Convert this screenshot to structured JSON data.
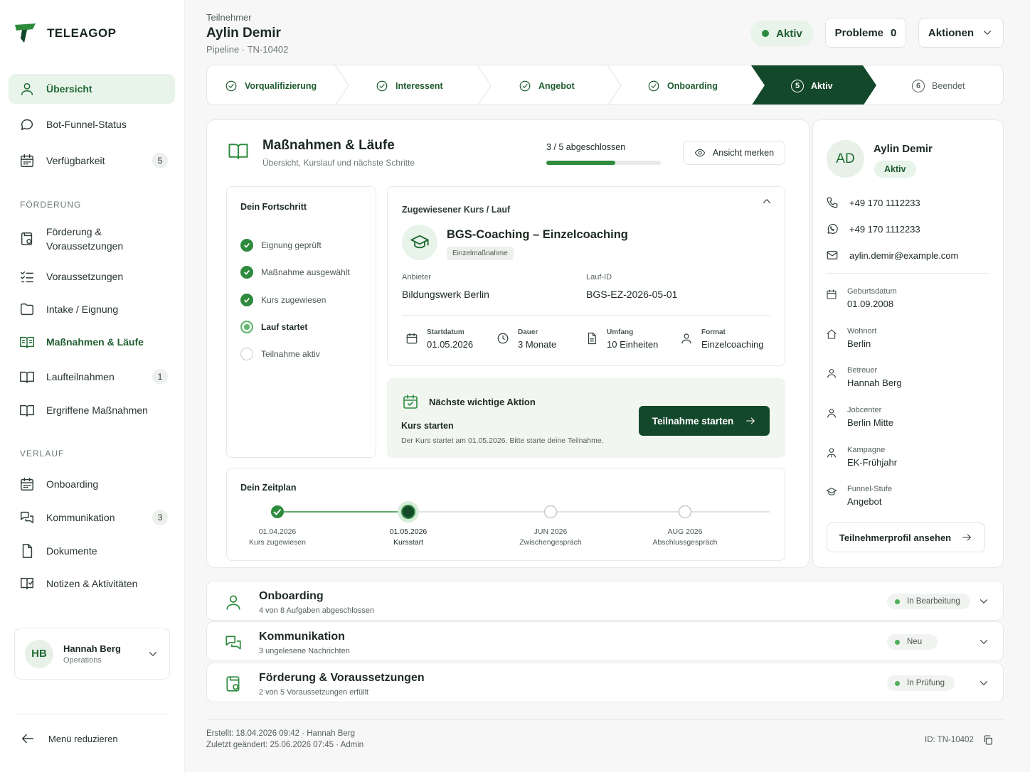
{
  "brand": {
    "name": "TELEAGOP"
  },
  "sidebar": {
    "items": [
      {
        "label": "Übersicht"
      },
      {
        "label": "Bot-Funnel-Status"
      },
      {
        "label": "Verfügbarkeit",
        "badge": "5"
      }
    ],
    "section_foerderung": "FÖRDERUNG",
    "foerderung_items": [
      {
        "label": "Förderung & Voraussetzungen"
      },
      {
        "label": "Voraussetzungen"
      },
      {
        "label": "Intake / Eignung"
      },
      {
        "label": "Maßnahmen & Läufe"
      },
      {
        "label": "Laufteilnahmen",
        "badge": "1"
      },
      {
        "label": "Ergriffene Maßnahmen"
      }
    ],
    "section_verlauf": "VERLAUF",
    "verlauf_items": [
      {
        "label": "Onboarding"
      },
      {
        "label": "Kommunikation",
        "badge": "3"
      },
      {
        "label": "Dokumente"
      },
      {
        "label": "Notizen & Aktivitäten"
      }
    ],
    "user": {
      "initials": "HB",
      "name": "Hannah Berg",
      "role": "Operations"
    },
    "collapse_label": "Menü reduzieren"
  },
  "header": {
    "crumb": "Teilnehmer",
    "name": "Aylin Demir",
    "sub": "Pipeline · TN-10402",
    "status": "Aktiv",
    "problems_label": "Probleme",
    "problems_count": "0",
    "actions_label": "Aktionen"
  },
  "stepper": [
    {
      "label": "Vorqualifizierung",
      "state": "done"
    },
    {
      "label": "Interessent",
      "state": "done"
    },
    {
      "label": "Angebot",
      "state": "done"
    },
    {
      "label": "Onboarding",
      "state": "done"
    },
    {
      "label": "Aktiv",
      "num": "5",
      "state": "current"
    },
    {
      "label": "Beendet",
      "num": "6",
      "state": "future"
    }
  ],
  "measures": {
    "title": "Maßnahmen & Läufe",
    "subtitle": "Übersicht, Kurslauf und nächste Schritte",
    "progress_text": "3 / 5 abgeschlossen",
    "progress_fraction": 0.6,
    "save_view": "Ansicht merken",
    "progress_title": "Dein Fortschritt",
    "progress_steps": [
      {
        "label": "Eignung geprüft",
        "state": "done"
      },
      {
        "label": "Maßnahme ausgewählt",
        "state": "done"
      },
      {
        "label": "Kurs zugewiesen",
        "state": "done"
      },
      {
        "label": "Lauf startet",
        "state": "current"
      },
      {
        "label": "Teilnahme aktiv",
        "state": "todo"
      }
    ],
    "course": {
      "heading": "Zugewiesener Kurs / Lauf",
      "name": "BGS-Coaching – Einzelcoaching",
      "tag": "Einzelmaßnahme",
      "provider_label": "Anbieter",
      "provider": "Bildungswerk Berlin",
      "run_label": "Lauf-ID",
      "run_id": "BGS-EZ-2026-05-01",
      "facts": [
        {
          "label": "Startdatum",
          "value": "01.05.2026",
          "icon": "calendar-icon"
        },
        {
          "label": "Dauer",
          "value": "3 Monate",
          "icon": "clock-icon"
        },
        {
          "label": "Umfang",
          "value": "10 Einheiten",
          "icon": "document-icon"
        },
        {
          "label": "Format",
          "value": "Einzelcoaching",
          "icon": "person-icon"
        }
      ]
    },
    "next_action": {
      "heading": "Nächste wichtige Aktion",
      "title": "Kurs starten",
      "text": "Der Kurs startet am 01.05.2026. Bitte starte deine Teilnahme.",
      "button": "Teilnahme starten"
    },
    "timeline": {
      "title": "Dein Zeitplan",
      "points": [
        {
          "date": "01.04.2026",
          "label": "Kurs zugewiesen",
          "state": "done"
        },
        {
          "date": "01.05.2026",
          "label": "Kursstart",
          "state": "current"
        },
        {
          "date": "JUN 2026",
          "label": "Zwischengespräch",
          "state": "todo"
        },
        {
          "date": "AUG 2026",
          "label": "Abschlussgespräch",
          "state": "todo"
        }
      ]
    }
  },
  "profile": {
    "initials": "AD",
    "name": "Aylin Demir",
    "status": "Aktiv",
    "phone": "+49 170 1112233",
    "whatsapp": "+49 170 1112233",
    "email": "aylin.demir@example.com",
    "fields": [
      {
        "label": "Geburtsdatum",
        "value": "01.09.2008"
      },
      {
        "label": "Wohnort",
        "value": "Berlin"
      },
      {
        "label": "Betreuer",
        "value": "Hannah Berg"
      },
      {
        "label": "Jobcenter",
        "value": "Berlin Mitte"
      },
      {
        "label": "Kampagne",
        "value": "EK-Frühjahr"
      },
      {
        "label": "Funnel-Stufe",
        "value": "Angebot"
      }
    ],
    "profile_button": "Teilnehmerprofil ansehen"
  },
  "sections": [
    {
      "title": "Onboarding",
      "sub": "4 von 8 Aufgaben abgeschlossen",
      "status": "In Bearbeitung"
    },
    {
      "title": "Kommunikation",
      "sub": "3 ungelesene Nachrichten",
      "status": "Neu"
    },
    {
      "title": "Förderung & Voraussetzungen",
      "sub": "2 von 5 Voraussetzungen erfüllt",
      "status": "In Prüfung"
    }
  ],
  "footer": {
    "created": "Erstellt:  18.04.2026 09:42  ·  Hannah Berg",
    "changed": "Zuletzt geändert:  25.06.2026 07:45  ·  Admin",
    "id": "ID: TN-10402"
  },
  "colors": {
    "accent": "#1f6b33",
    "dark": "#14482a",
    "success": "#2e8b3e"
  }
}
